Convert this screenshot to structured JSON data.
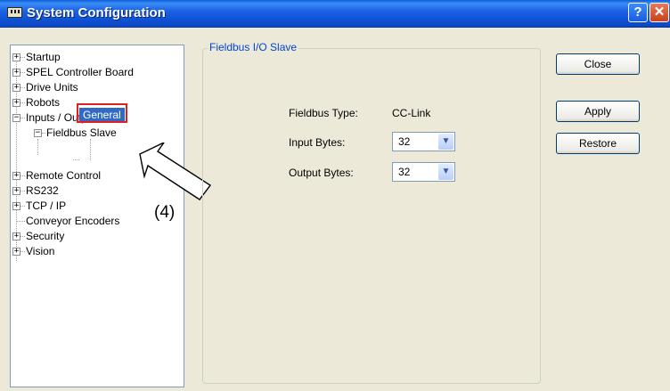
{
  "window": {
    "title": "System Configuration",
    "help_glyph": "?",
    "close_glyph": "✕"
  },
  "tree": {
    "nodes": [
      {
        "label": "Startup",
        "expander": "+"
      },
      {
        "label": "SPEL Controller Board",
        "expander": "+"
      },
      {
        "label": "Drive Units",
        "expander": "+"
      },
      {
        "label": "Robots",
        "expander": "+"
      },
      {
        "label": "Inputs / Outputs",
        "expander": "−"
      },
      {
        "label": "Fieldbus Slave",
        "expander": "−"
      },
      {
        "label": "General",
        "selected": true
      },
      {
        "label": "Remote Control",
        "expander": "+"
      },
      {
        "label": "RS232",
        "expander": "+"
      },
      {
        "label": "TCP / IP",
        "expander": "+"
      },
      {
        "label": "Conveyor Encoders"
      },
      {
        "label": "Security",
        "expander": "+"
      },
      {
        "label": "Vision",
        "expander": "+"
      }
    ]
  },
  "annotation": {
    "label": "(4)"
  },
  "panel": {
    "group_title": "Fieldbus I/O Slave",
    "fieldbus_type_label": "Fieldbus Type:",
    "fieldbus_type_value": "CC-Link",
    "input_bytes_label": "Input Bytes:",
    "input_bytes_value": "32",
    "output_bytes_label": "Output Bytes:",
    "output_bytes_value": "32",
    "dropdown_glyph": "▼"
  },
  "buttons": {
    "close": "Close",
    "apply": "Apply",
    "restore": "Restore"
  },
  "colors": {
    "selection": "#316ac5",
    "highlight_box": "#e02020",
    "group_title": "#0046d5"
  }
}
